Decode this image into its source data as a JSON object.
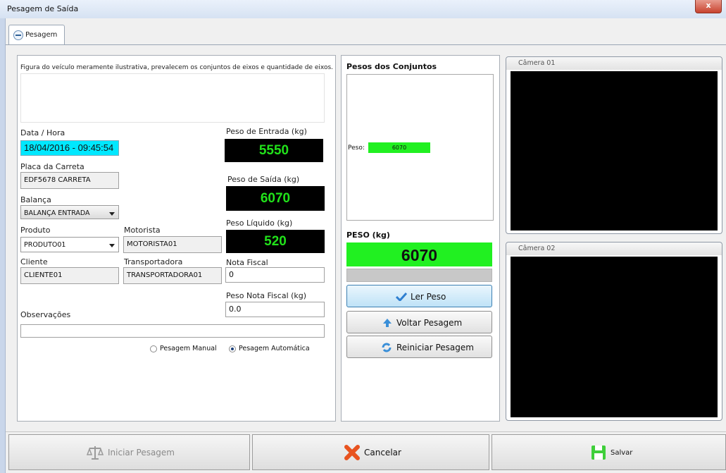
{
  "window": {
    "title": "Pesagem de Saída",
    "close_label": "x"
  },
  "tabs": [
    {
      "label": "Pesagem"
    }
  ],
  "form": {
    "disclaimer": "Figura do veículo meramente ilustrativa, prevalecem os conjuntos de eixos e quantidade de eixos.",
    "datahora_label": "Data / Hora",
    "datahora_value": "18/04/2016 - 09:45:54",
    "placa_label": "Placa da Carreta",
    "placa_value": "EDF5678 CARRETA",
    "balanca_label": "Balança",
    "balanca_value": "BALANÇA ENTRADA",
    "produto_label": "Produto",
    "produto_value": "PRODUTO01",
    "motorista_label": "Motorista",
    "motorista_value": "MOTORISTA01",
    "cliente_label": "Cliente",
    "cliente_value": "CLIENTE01",
    "transportadora_label": "Transportadora",
    "transportadora_value": "TRANSPORTADORA01",
    "peso_entrada_label": "Peso de Entrada (kg)",
    "peso_entrada_value": "5550",
    "peso_saida_label": "Peso de Saída (kg)",
    "peso_saida_value": "6070",
    "peso_liquido_label": "Peso Líquido (kg)",
    "peso_liquido_value": "520",
    "nota_fiscal_label": "Nota Fiscal",
    "nota_fiscal_value": "0",
    "peso_nota_label": "Peso Nota Fiscal (kg)",
    "peso_nota_value": "0.0",
    "observacoes_label": "Observações",
    "observacoes_value": "",
    "radio_manual": "Pesagem Manual",
    "radio_auto": "Pesagem Automática",
    "radio_selected": "auto"
  },
  "pesos": {
    "title": "Pesos dos Conjuntos",
    "peso_label": "Peso:",
    "peso_value": "6070",
    "peso_total_label": "PESO (kg)",
    "peso_total_value": "6070"
  },
  "actions": {
    "ler_peso": "Ler Peso",
    "voltar_pesagem": "Voltar Pesagem",
    "reiniciar_pesagem": "Reiniciar Pesagem"
  },
  "cameras": [
    {
      "label": "Câmera 01"
    },
    {
      "label": "Câmera 02"
    }
  ],
  "bottom": {
    "iniciar": "Iniciar Pesagem",
    "cancelar": "Cancelar",
    "salvar": "Salvar"
  },
  "colors": {
    "datetime_bg": "#00e8ff",
    "lcd_text": "#21e21a",
    "peso_bar": "#21f021"
  }
}
